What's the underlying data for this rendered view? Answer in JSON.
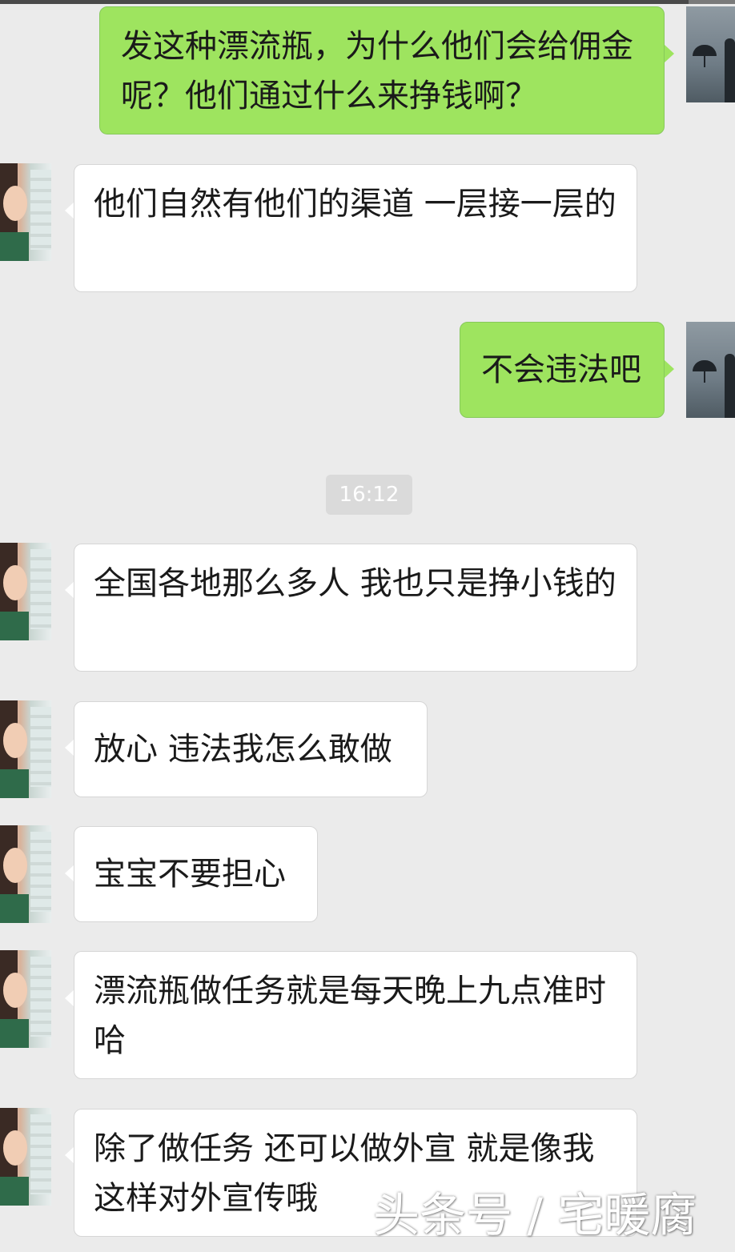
{
  "timestamp": "16:12",
  "messages": [
    {
      "side": "out",
      "text": "发这种漂流瓶，为什么他们会给佣金呢？他们通过什么来挣钱啊？"
    },
    {
      "side": "in",
      "text": "他们自然有他们的渠道  一层接一层的"
    },
    {
      "side": "out",
      "text": "不会违法吧"
    },
    {
      "side": "in",
      "text": "全国各地那么多人 我也只是挣小钱的"
    },
    {
      "side": "in",
      "text": "放心 违法我怎么敢做"
    },
    {
      "side": "in",
      "text": "宝宝不要担心"
    },
    {
      "side": "in",
      "text": "漂流瓶做任务就是每天晚上九点准时哈"
    },
    {
      "side": "in",
      "text": "除了做任务 还可以做外宣 就是像我这样对外宣传哦"
    }
  ],
  "watermark": "头条号 / 宅暖腐",
  "colors": {
    "background": "#ebebeb",
    "outgoing_bubble": "#9ee45f",
    "incoming_bubble": "#ffffff",
    "timestamp_bg": "#dadada"
  },
  "icons": {
    "incoming_avatar": "contact-avatar-icon",
    "outgoing_avatar": "self-avatar-icon"
  }
}
